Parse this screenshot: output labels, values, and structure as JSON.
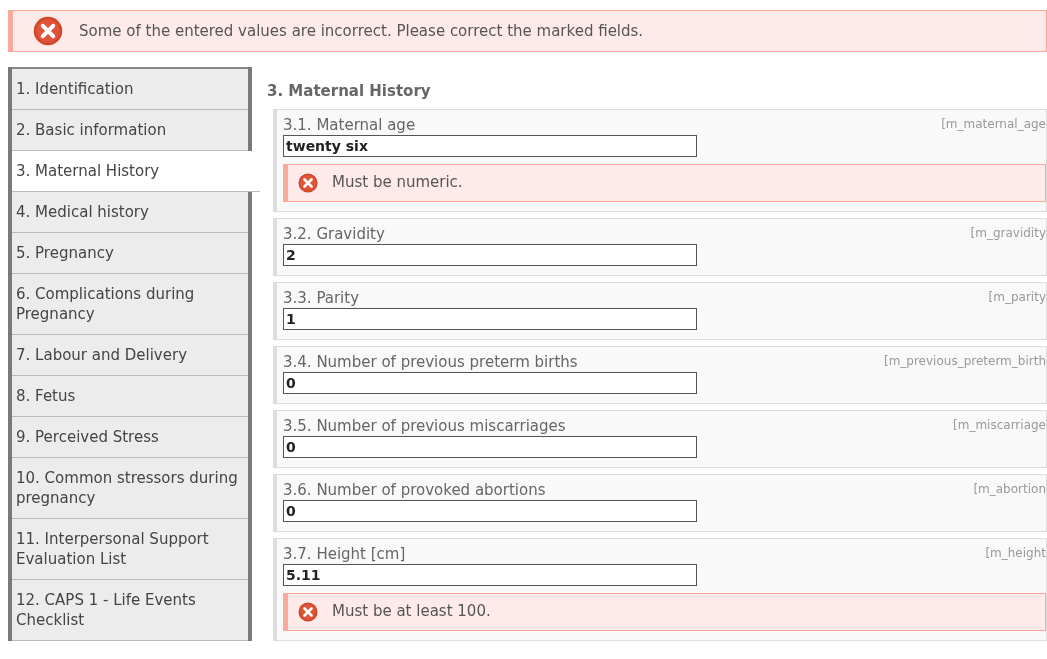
{
  "alert": {
    "kind": "error",
    "message": "Some of the entered values are incorrect. Please correct the marked fields."
  },
  "sidebar": {
    "items": [
      {
        "label": "1. Identification",
        "selected": false
      },
      {
        "label": "2. Basic information",
        "selected": false
      },
      {
        "label": "3. Maternal History",
        "selected": true
      },
      {
        "label": "4. Medical history",
        "selected": false
      },
      {
        "label": "5. Pregnancy",
        "selected": false
      },
      {
        "label": "6. Complications during Pregnancy",
        "selected": false
      },
      {
        "label": "7. Labour and Delivery",
        "selected": false
      },
      {
        "label": "8. Fetus",
        "selected": false
      },
      {
        "label": "9. Perceived Stress",
        "selected": false
      },
      {
        "label": "10. Common stressors during pregnancy",
        "selected": false
      },
      {
        "label": "11. Interpersonal Support Evaluation List",
        "selected": false
      },
      {
        "label": "12. CAPS 1 - Life Events Checklist",
        "selected": false
      }
    ]
  },
  "section": {
    "title": "3. Maternal History",
    "fields": [
      {
        "label": "3.1. Maternal age",
        "code": "[m_maternal_age",
        "value": "twenty six",
        "error": "Must be numeric."
      },
      {
        "label": "3.2. Gravidity",
        "code": "[m_gravidity",
        "value": "2"
      },
      {
        "label": "3.3. Parity",
        "code": "[m_parity",
        "value": "1"
      },
      {
        "label": "3.4. Number of previous preterm births",
        "code": "[m_previous_preterm_birth",
        "value": "0"
      },
      {
        "label": "3.5. Number of previous miscarriages",
        "code": "[m_miscarriage",
        "value": "0"
      },
      {
        "label": "3.6. Number of provoked abortions",
        "code": "[m_abortion",
        "value": "0"
      },
      {
        "label": "3.7. Height [cm]",
        "code": "[m_height",
        "value": "5.11",
        "error": "Must be at least 100."
      }
    ]
  }
}
